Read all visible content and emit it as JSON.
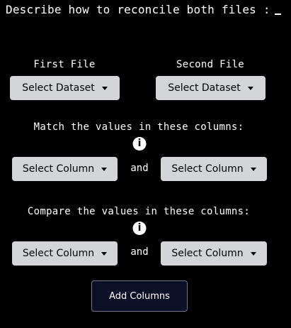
{
  "prompt": {
    "text": "Describe how to reconcile both files :"
  },
  "files": {
    "first_label": "First File",
    "second_label": "Second File",
    "first_select": "Select Dataset",
    "second_select": "Select Dataset"
  },
  "match": {
    "heading": "Match the values in these columns:",
    "left_select": "Select Column",
    "right_select": "Select Column",
    "joiner": "and",
    "info_icon": "info-icon"
  },
  "compare": {
    "heading": "Compare the values in these columns:",
    "left_select": "Select Column",
    "right_select": "Select Column",
    "joiner": "and",
    "info_icon": "info-icon"
  },
  "actions": {
    "add_columns": "Add Columns"
  },
  "colors": {
    "background": "#000000",
    "dropdown_bg": "#d4d5d9",
    "button_bg": "#0c1026",
    "button_border": "#6e7388"
  }
}
